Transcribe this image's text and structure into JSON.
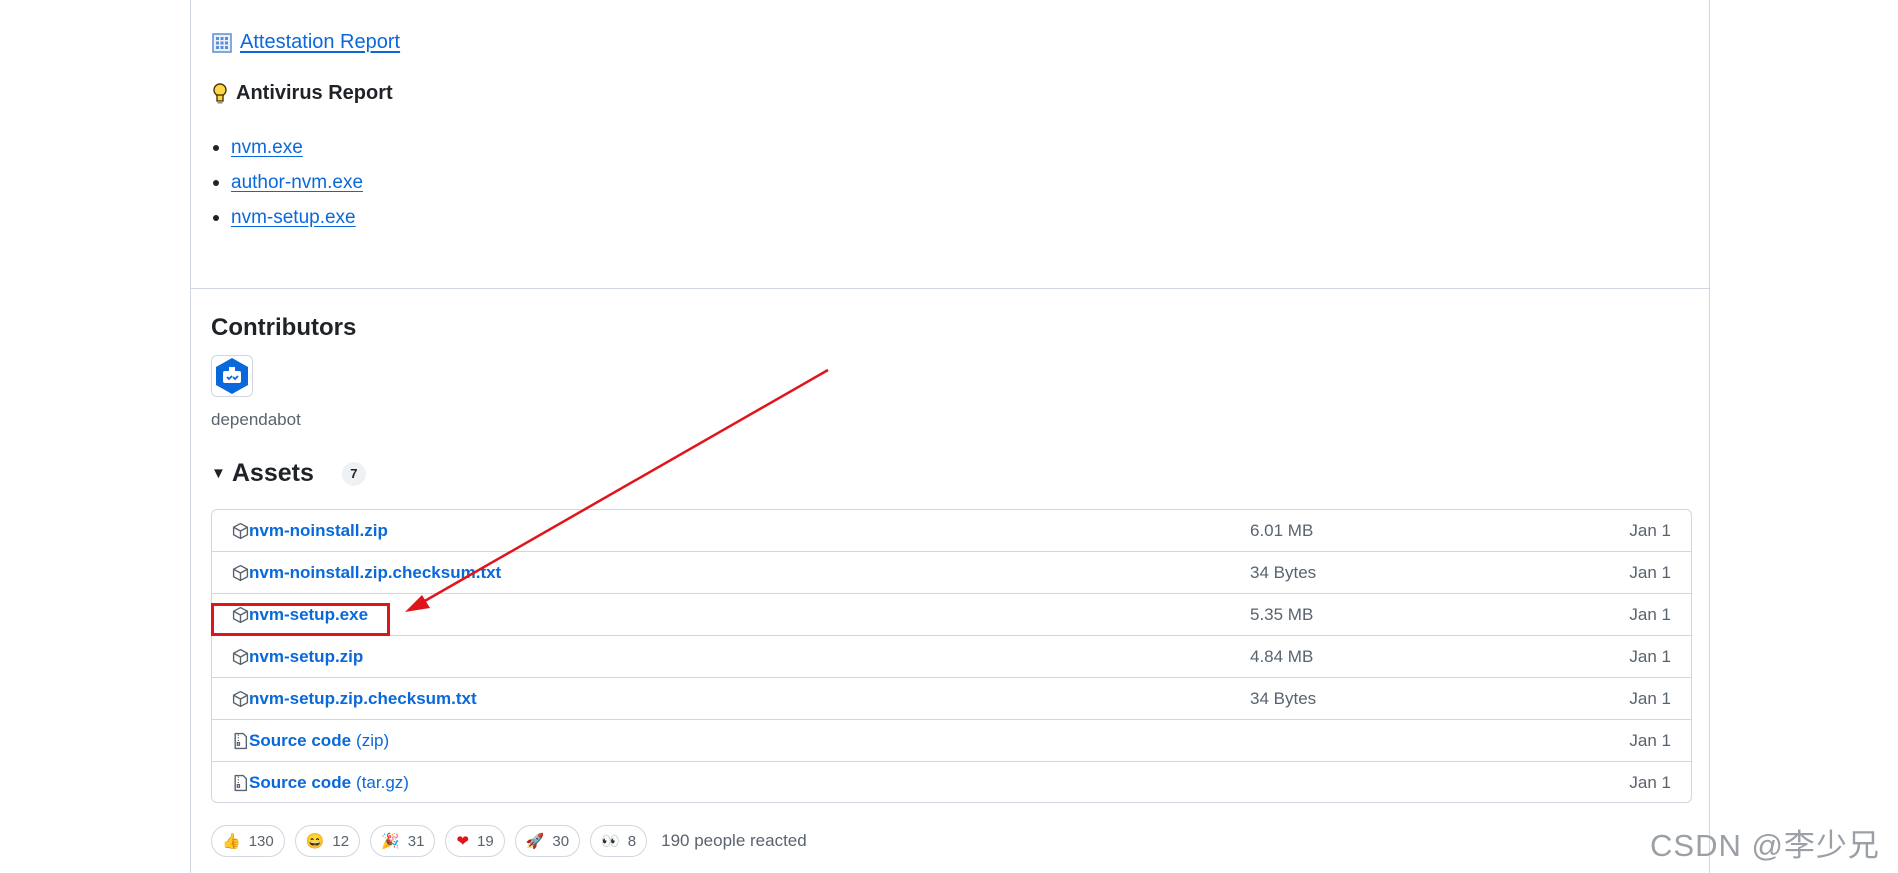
{
  "attestation": {
    "label": "Attestation Report",
    "icon": "building-emoji-icon"
  },
  "antivirus": {
    "title": "Antivirus Report",
    "icon": "lightbulb-emoji-icon",
    "items": [
      "nvm.exe",
      "author-nvm.exe",
      "nvm-setup.exe"
    ]
  },
  "contributors": {
    "title": "Contributors",
    "name": "dependabot",
    "icon": "dependabot-avatar-icon"
  },
  "assets": {
    "title": "Assets",
    "count": "7",
    "rows": [
      {
        "name": "nvm-noinstall.zip",
        "ext": "",
        "size": "6.01 MB",
        "date": "Jan 1",
        "icon": "package-icon"
      },
      {
        "name": "nvm-noinstall.zip.checksum.txt",
        "ext": "",
        "size": "34 Bytes",
        "date": "Jan 1",
        "icon": "package-icon"
      },
      {
        "name": "nvm-setup.exe",
        "ext": "",
        "size": "5.35 MB",
        "date": "Jan 1",
        "icon": "package-icon"
      },
      {
        "name": "nvm-setup.zip",
        "ext": "",
        "size": "4.84 MB",
        "date": "Jan 1",
        "icon": "package-icon"
      },
      {
        "name": "nvm-setup.zip.checksum.txt",
        "ext": "",
        "size": "34 Bytes",
        "date": "Jan 1",
        "icon": "package-icon"
      },
      {
        "name": "Source code",
        "ext": "(zip)",
        "size": "",
        "date": "Jan 1",
        "icon": "file-zip-icon"
      },
      {
        "name": "Source code",
        "ext": "(tar.gz)",
        "size": "",
        "date": "Jan 1",
        "icon": "file-zip-icon"
      }
    ]
  },
  "reactions": {
    "items": [
      {
        "emoji": "👍",
        "count": "130",
        "icon": "thumbs-up-icon"
      },
      {
        "emoji": "😄",
        "count": "12",
        "icon": "laugh-icon"
      },
      {
        "emoji": "🎉",
        "count": "31",
        "icon": "hooray-icon"
      },
      {
        "emoji": "❤",
        "count": "19",
        "icon": "heart-icon"
      },
      {
        "emoji": "🚀",
        "count": "30",
        "icon": "rocket-icon"
      },
      {
        "emoji": "👀",
        "count": "8",
        "icon": "eyes-icon"
      }
    ],
    "summary": "190 people reacted"
  },
  "watermark": "CSDN @李少兄",
  "colors": {
    "link": "#0969da",
    "annotation": "#e0151c",
    "muted": "#59636e",
    "border": "#d0d7de"
  }
}
